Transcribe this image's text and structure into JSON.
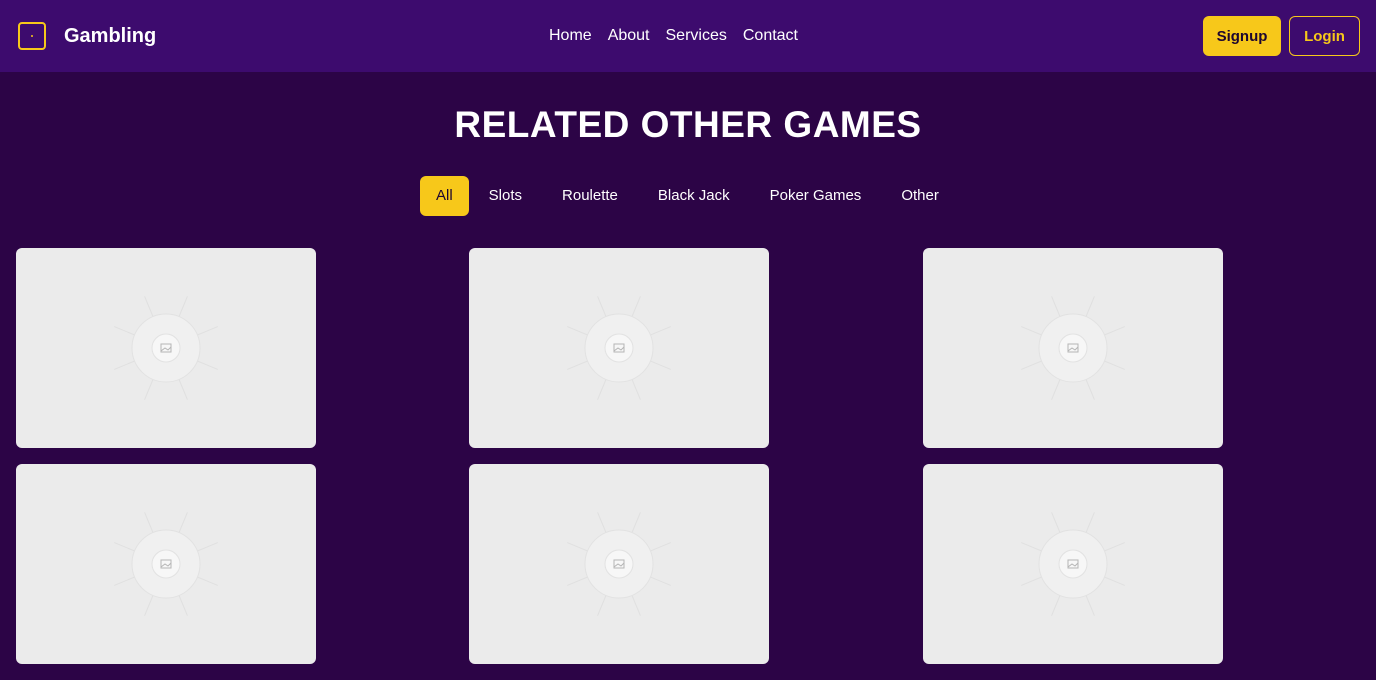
{
  "header": {
    "brand": "Gambling",
    "logo_icon": "dice-icon",
    "nav": [
      "Home",
      "About",
      "Services",
      "Contact"
    ],
    "signup_label": "Signup",
    "login_label": "Login"
  },
  "section": {
    "title": "RELATED OTHER GAMES",
    "filters": [
      "All",
      "Slots",
      "Roulette",
      "Black Jack",
      "Poker Games",
      "Other"
    ],
    "active_filter": "All"
  },
  "games": {
    "cards": [
      {
        "icon": "image-placeholder-icon"
      },
      {
        "icon": "image-placeholder-icon"
      },
      {
        "icon": "image-placeholder-icon"
      },
      {
        "icon": "image-placeholder-icon"
      },
      {
        "icon": "image-placeholder-icon"
      },
      {
        "icon": "image-placeholder-icon"
      }
    ]
  },
  "colors": {
    "background": "#2c0446",
    "navbar": "#3d0b6e",
    "accent": "#f7c81a",
    "card": "#ebebeb"
  }
}
